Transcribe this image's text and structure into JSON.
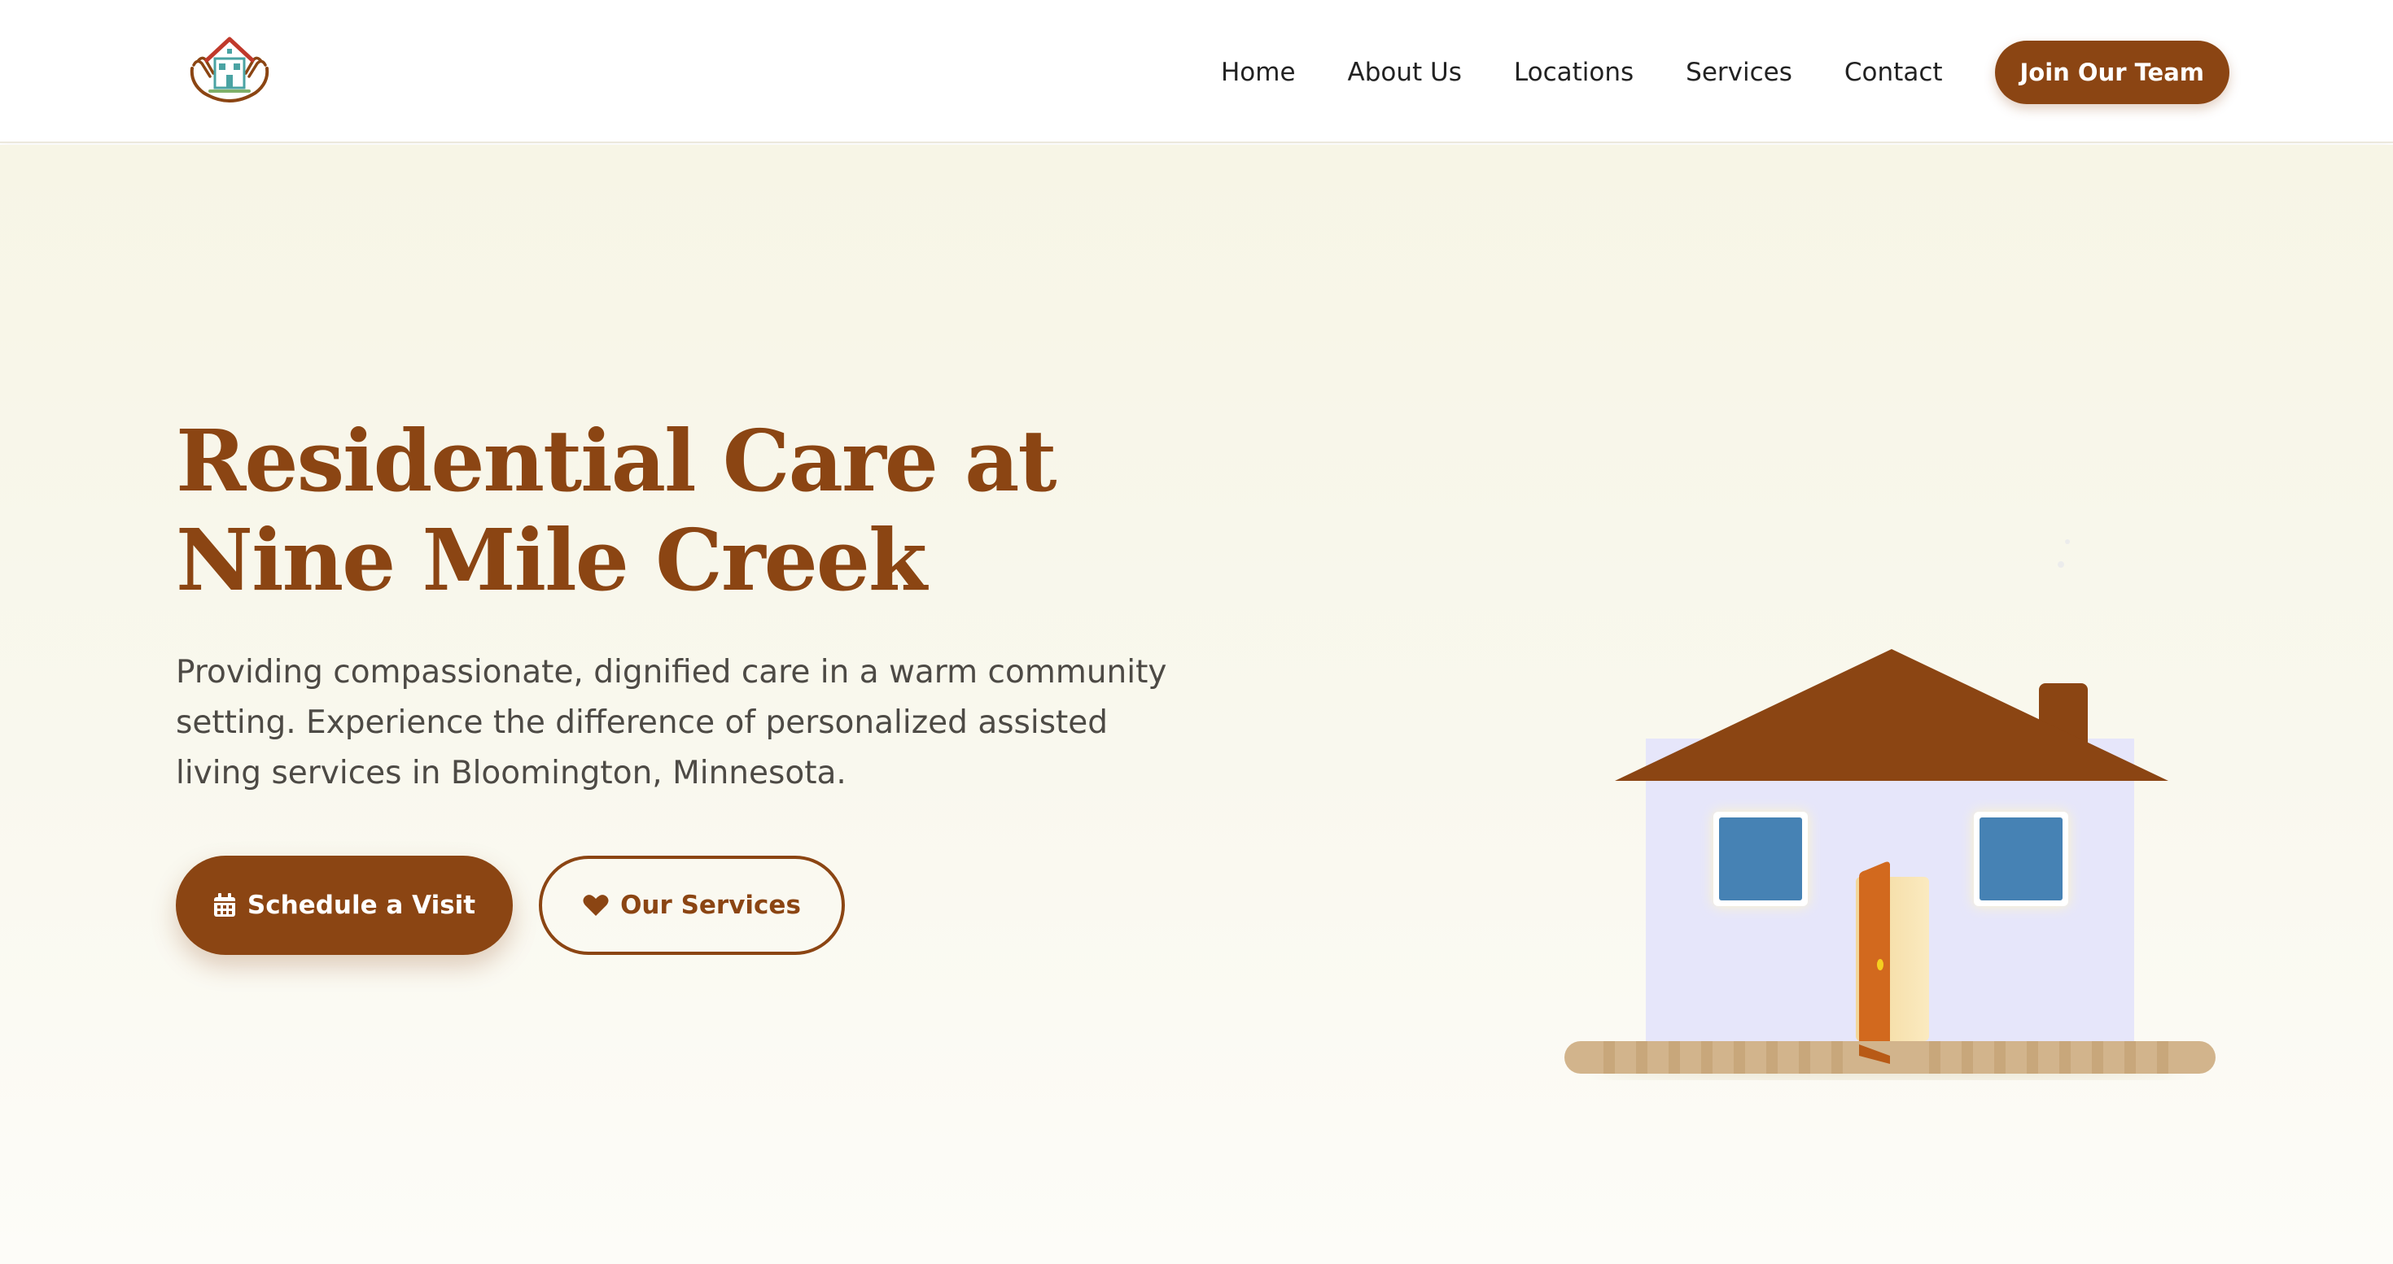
{
  "nav": {
    "items": [
      "Home",
      "About Us",
      "Locations",
      "Services",
      "Contact"
    ],
    "cta_label": "Join Our Team"
  },
  "hero": {
    "title_line1": "Residential Care at",
    "title_line2": "Nine Mile Creek",
    "description": "Providing compassionate, dignified care in a warm community setting. Experience the difference of personalized assisted living services in Bloomington, Minnesota.",
    "primary_button": "Schedule a Visit",
    "primary_icon": "calendar-icon",
    "secondary_button": "Our Services",
    "secondary_icon": "heart-icon"
  },
  "colors": {
    "brand_brown": "#8b4513",
    "door_orange": "#d2691e",
    "window_blue": "#4682b4",
    "house_wall": "#e6e6fa",
    "path_tan": "#d2b48c",
    "hero_bg": "#f7f5e6"
  }
}
